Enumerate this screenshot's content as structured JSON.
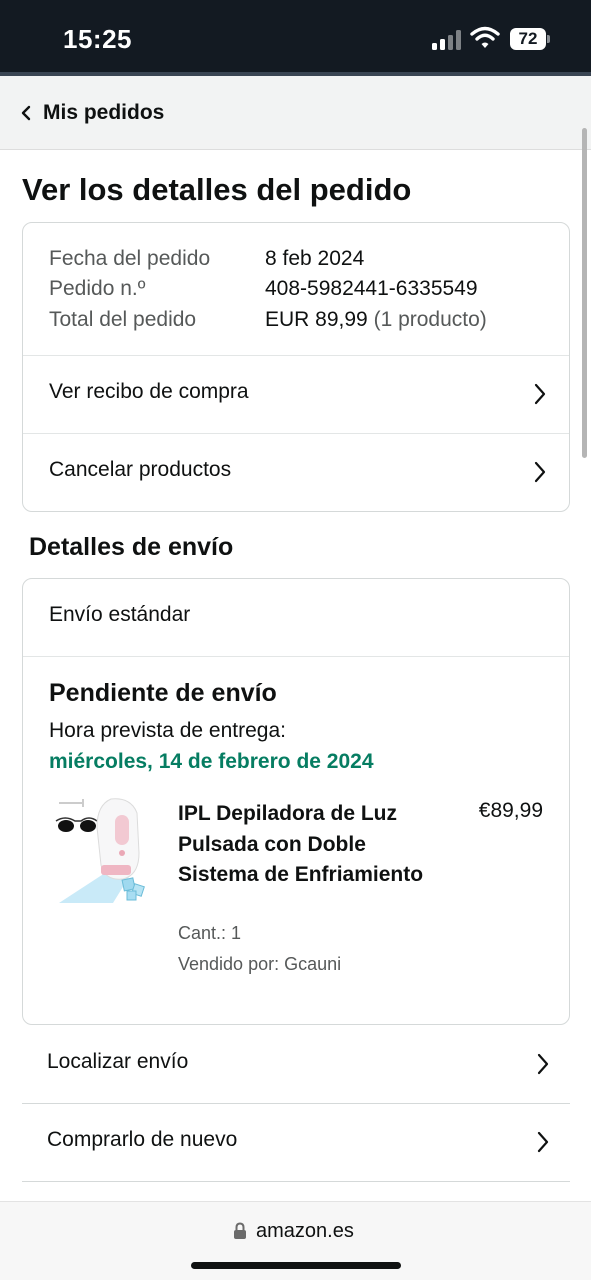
{
  "status_bar": {
    "time": "15:25",
    "battery_level": "72",
    "icons": [
      "signal-icon",
      "wifi-icon",
      "battery-icon"
    ]
  },
  "nav": {
    "back_label": "Mis pedidos",
    "back_icon": "chevron-left-icon"
  },
  "page": {
    "title": "Ver los detalles del pedido"
  },
  "order_summary": {
    "date_label": "Fecha del pedido",
    "date_value": "8 feb 2024",
    "number_label": "Pedido n.º",
    "number_value": "408-5982441-6335549",
    "total_label": "Total del pedido",
    "total_value": "EUR 89,99",
    "total_items": "(1 producto)",
    "actions": [
      {
        "label": "Ver recibo de compra",
        "icon": "chevron-right-icon"
      },
      {
        "label": "Cancelar productos",
        "icon": "chevron-right-icon"
      }
    ]
  },
  "shipping": {
    "section_title": "Detalles de envío",
    "method": "Envío estándar",
    "status": "Pendiente de envío",
    "eta_label": "Hora prevista de entrega:",
    "eta_date": "miércoles, 14 de febrero de 2024",
    "product": {
      "title": "IPL Depiladora de Luz Pulsada con Doble Sistema de Enfriamiento",
      "price": "€89,99",
      "quantity": "Cant.: 1",
      "seller": "Vendido por: Gcauni",
      "image_icon": "ipl-device-image"
    },
    "actions": [
      {
        "label": "Localizar envío",
        "icon": "chevron-right-icon"
      },
      {
        "label": "Comprarlo de nuevo",
        "icon": "chevron-right-icon"
      }
    ]
  },
  "browser_bar": {
    "domain": "amazon.es",
    "icon": "lock-icon"
  },
  "colors": {
    "status_bar_bg": "#131a22",
    "eta_green": "#067d62",
    "text_primary": "#0f1111",
    "text_secondary": "#565959",
    "border": "#d5d9d9"
  }
}
